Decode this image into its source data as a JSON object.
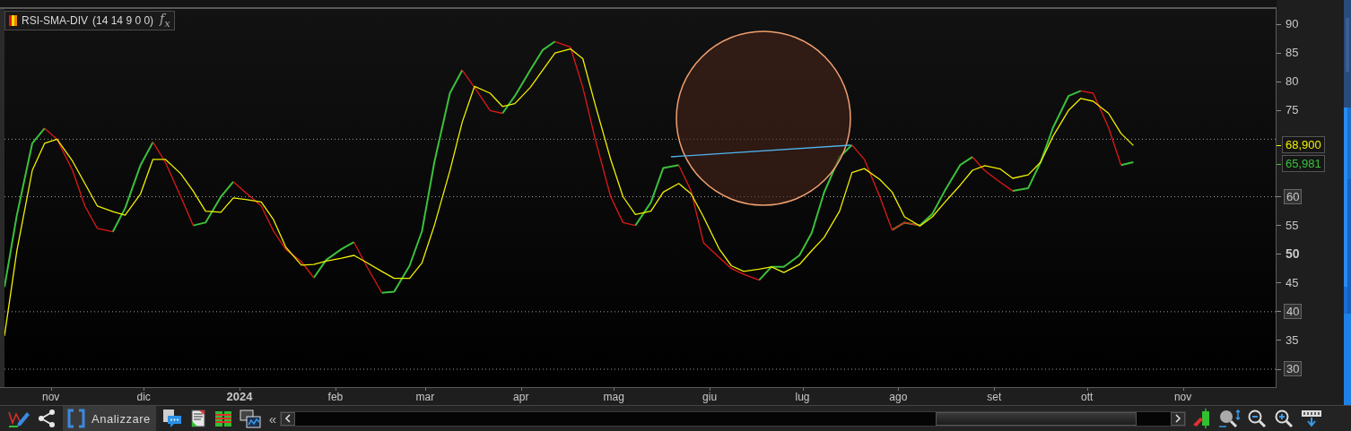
{
  "indicator": {
    "name": "RSI-SMA-DIV",
    "params": "(14 14 9 0 0)",
    "formula_button": "f$_{x}$"
  },
  "chart": {
    "chart_data": {
      "type": "line",
      "xlim": [
        "2023-10-17",
        "2024-12-01"
      ],
      "ylim": [
        26.89,
        92.65
      ],
      "x": [
        "2023-10-17",
        "2023-10-21",
        "2023-10-26",
        "2023-10-30",
        "2023-11-03",
        "2023-11-08",
        "2023-11-12",
        "2023-11-16",
        "2023-11-21",
        "2023-11-25",
        "2023-11-30",
        "2023-12-04",
        "2023-12-08",
        "2023-12-13",
        "2023-12-17",
        "2023-12-21",
        "2023-12-26",
        "2023-12-30",
        "2024-01-03",
        "2024-01-08",
        "2024-01-12",
        "2024-01-16",
        "2024-01-21",
        "2024-01-25",
        "2024-01-29",
        "2024-02-03",
        "2024-02-07",
        "2024-02-11",
        "2024-02-16",
        "2024-02-20",
        "2024-02-25",
        "2024-02-29",
        "2024-03-04",
        "2024-03-09",
        "2024-03-13",
        "2024-03-17",
        "2024-03-22",
        "2024-03-26",
        "2024-03-30",
        "2024-04-04",
        "2024-04-08",
        "2024-04-12",
        "2024-04-17",
        "2024-04-21",
        "2024-04-25",
        "2024-04-30",
        "2024-05-04",
        "2024-05-08",
        "2024-05-13",
        "2024-05-17",
        "2024-05-22",
        "2024-05-26",
        "2024-05-30",
        "2024-06-04",
        "2024-06-08",
        "2024-06-12",
        "2024-06-17",
        "2024-06-21",
        "2024-06-25",
        "2024-06-30",
        "2024-07-04",
        "2024-07-08",
        "2024-07-13",
        "2024-07-17",
        "2024-07-21",
        "2024-07-26",
        "2024-07-30",
        "2024-08-03",
        "2024-08-08",
        "2024-08-12",
        "2024-08-16",
        "2024-08-21",
        "2024-08-25",
        "2024-08-29",
        "2024-09-03",
        "2024-09-07",
        "2024-09-12",
        "2024-09-16",
        "2024-09-20",
        "2024-09-25",
        "2024-09-29",
        "2024-10-03",
        "2024-10-08",
        "2024-10-12",
        "2024-10-16"
      ],
      "series": [
        {
          "color": "#3cc03c",
          "values": [
            44.3,
            56.8,
            69.3,
            71.9,
            null,
            null,
            null,
            null,
            53.9,
            58,
            65.5,
            69.5,
            null,
            null,
            55,
            55.5,
            60,
            62.6,
            null,
            null,
            null,
            null,
            null,
            45.9,
            49,
            50.9,
            52.1,
            null,
            43.3,
            43.5,
            48,
            54,
            66,
            78,
            82,
            null,
            null,
            74.5,
            77.5,
            82,
            85.5,
            87,
            null,
            null,
            null,
            null,
            null,
            55,
            59,
            65,
            65.5,
            null,
            null,
            null,
            null,
            null,
            45.5,
            47.8,
            47.8,
            49.8,
            53.7,
            60.7,
            66.9,
            69,
            null,
            null,
            54.2,
            55.5,
            55,
            57,
            61,
            65.5,
            66.9,
            null,
            null,
            61,
            61.5,
            66,
            72,
            77.5,
            78.4,
            null,
            null,
            65.5,
            66
          ]
        },
        {
          "color": "#e01818",
          "values": [
            null,
            null,
            null,
            71.9,
            70,
            64.6,
            58.4,
            54.5,
            53.9,
            null,
            null,
            69.5,
            66,
            60,
            55,
            null,
            null,
            62.6,
            60.7,
            58.4,
            54,
            50.8,
            48.7,
            45.9,
            null,
            null,
            52.1,
            48,
            43.3,
            null,
            null,
            null,
            null,
            null,
            82,
            79,
            75,
            74.5,
            null,
            null,
            null,
            87,
            86,
            79,
            70,
            60,
            55.5,
            55,
            null,
            null,
            65.5,
            61,
            52,
            49.5,
            47.5,
            46.5,
            45.5,
            null,
            null,
            null,
            null,
            null,
            null,
            69,
            66.5,
            60,
            54.2,
            55.5,
            55,
            null,
            null,
            null,
            66.9,
            64.5,
            62.5,
            61,
            null,
            null,
            null,
            null,
            78.4,
            78,
            72,
            65.5,
            null
          ]
        },
        {
          "color": "#f0f000",
          "values": [
            35.8,
            50.6,
            64.6,
            69.3,
            70,
            66.2,
            62.3,
            58.4,
            57.4,
            56.8,
            60.5,
            66.5,
            66.5,
            64,
            61,
            57.5,
            57.3,
            59.8,
            59.5,
            59.1,
            56,
            51.2,
            48.1,
            48.2,
            48.8,
            49.3,
            49.8,
            48.6,
            47,
            45.8,
            45.8,
            48.5,
            55,
            64.5,
            73,
            79.2,
            78,
            75.7,
            76.2,
            79,
            82,
            85,
            85.7,
            84,
            76,
            66.5,
            60,
            56.9,
            57.5,
            60.8,
            62.3,
            60.5,
            56.5,
            51,
            48,
            47,
            47.4,
            47.8,
            46.8,
            48.2,
            50.6,
            52.9,
            57.5,
            64.2,
            64.9,
            63,
            60.8,
            56.5,
            54.9,
            56.5,
            59,
            62,
            64.6,
            65.4,
            64.8,
            63.2,
            63.8,
            66,
            70.5,
            75,
            77.1,
            76.6,
            74.5,
            71,
            68.9
          ]
        }
      ],
      "yticks": [
        30,
        35,
        40,
        45,
        50,
        55,
        60,
        75,
        80,
        85,
        90
      ],
      "xticks": [
        {
          "value": "2023-11-01",
          "label": "nov"
        },
        {
          "value": "2023-12-01",
          "label": "dic"
        },
        {
          "value": "2024-01-01",
          "label": "2024"
        },
        {
          "value": "2024-02-01",
          "label": "feb"
        },
        {
          "value": "2024-03-01",
          "label": "mar"
        },
        {
          "value": "2024-04-01",
          "label": "apr"
        },
        {
          "value": "2024-05-01",
          "label": "mag"
        },
        {
          "value": "2024-06-01",
          "label": "giu"
        },
        {
          "value": "2024-07-01",
          "label": "lug"
        },
        {
          "value": "2024-08-01",
          "label": "ago"
        },
        {
          "value": "2024-09-01",
          "label": "set"
        },
        {
          "value": "2024-10-01",
          "label": "ott"
        },
        {
          "value": "2024-11-01",
          "label": "nov"
        }
      ],
      "ref_lines": [
        {
          "axis": "y",
          "value": 70
        },
        {
          "axis": "y",
          "value": 60
        },
        {
          "axis": "y",
          "value": 40
        },
        {
          "axis": "y",
          "value": 30
        }
      ]
    },
    "value_tags": [
      "68,900",
      "65,981"
    ]
  },
  "toolbar": {
    "analyze_button": "Analizzare",
    "collapse_button": "«"
  }
}
